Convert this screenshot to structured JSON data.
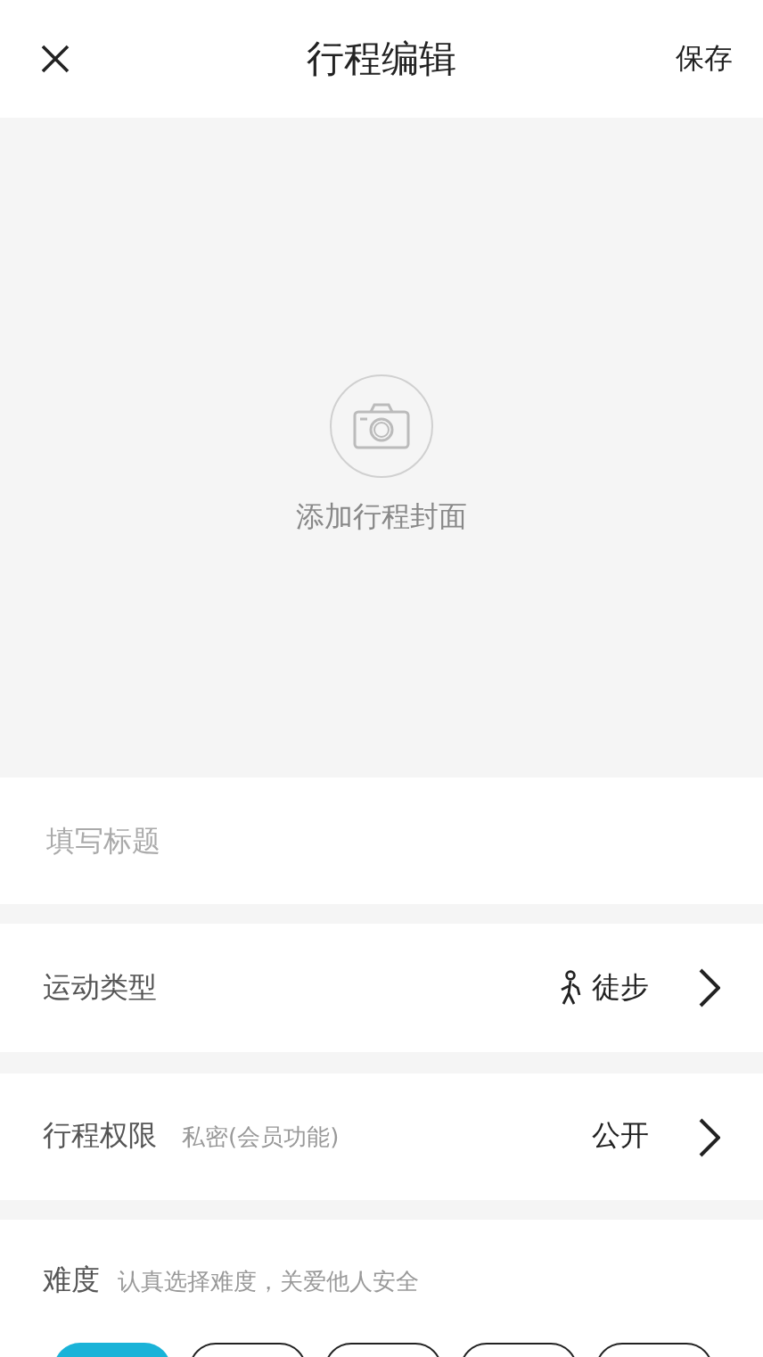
{
  "header": {
    "title": "行程编辑",
    "save": "保存"
  },
  "cover": {
    "label": "添加行程封面"
  },
  "title_field": {
    "placeholder": "填写标题"
  },
  "sport_type": {
    "label": "运动类型",
    "value": "徒步"
  },
  "permission": {
    "label": "行程权限",
    "hint": "私密(会员功能)",
    "value": "公开"
  },
  "difficulty": {
    "label": "难度",
    "hint": "认真选择难度，关爱他人安全",
    "options": [
      {
        "selected": true
      },
      {
        "selected": false
      },
      {
        "selected": false
      },
      {
        "selected": false
      },
      {
        "selected": false
      }
    ]
  }
}
